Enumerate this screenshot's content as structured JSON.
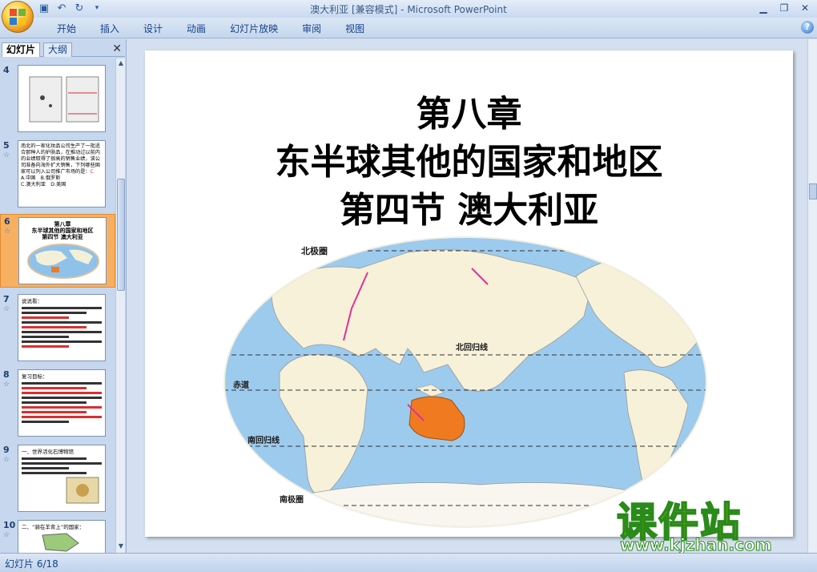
{
  "window": {
    "title_doc": "澳大利亚 [兼容模式]",
    "title_sep": " - ",
    "title_app": "Microsoft PowerPoint"
  },
  "quick_access": [
    "save-icon",
    "undo-icon",
    "redo-icon",
    "customize-icon"
  ],
  "ribbon": {
    "tabs": [
      "开始",
      "插入",
      "设计",
      "动画",
      "幻灯片放映",
      "审阅",
      "视图"
    ]
  },
  "panel": {
    "tab_slides": "幻灯片",
    "tab_outline": "大纲",
    "close": "✕"
  },
  "thumbnails": [
    {
      "num": "4",
      "star": ""
    },
    {
      "num": "5",
      "star": "☆",
      "text": "南北的一家化妆品公司生产了一批适合那种人的护肤品，在推动过以前内的业绩取得了很高的销售业绩，该公司准备向海外扩大销售，下列哪些国家可以列入公司推广市场的是：",
      "answer": "C",
      "options": [
        "A.中国　B.俄罗斯",
        "C.澳大利亚　D.美国"
      ]
    },
    {
      "num": "6",
      "star": "☆",
      "lines": [
        "第八章",
        "东半球其他的国家和地区",
        "第四节 澳大利亚"
      ]
    },
    {
      "num": "7",
      "star": "☆",
      "label": "说说看："
    },
    {
      "num": "8",
      "star": "☆",
      "label": "复习目标："
    },
    {
      "num": "9",
      "star": "☆",
      "label": "一、世界活化石博物馆"
    },
    {
      "num": "10",
      "star": "☆",
      "label": "二、“骑在羊背上”的国家："
    }
  ],
  "slide": {
    "title1": "第八章",
    "title2": "东半球其他的国家和地区",
    "title3": "第四节  澳大利亚",
    "map_labels": {
      "north_polar": "北极圈",
      "tropic_cancer": "北回归线",
      "equator": "赤道",
      "tropic_capricorn": "南回归线",
      "south_polar": "南极圈"
    }
  },
  "watermark": {
    "main": "课件站",
    "url": "www.kjzhan.com"
  },
  "statusbar": {
    "slide_info": "幻灯片 6/18"
  }
}
